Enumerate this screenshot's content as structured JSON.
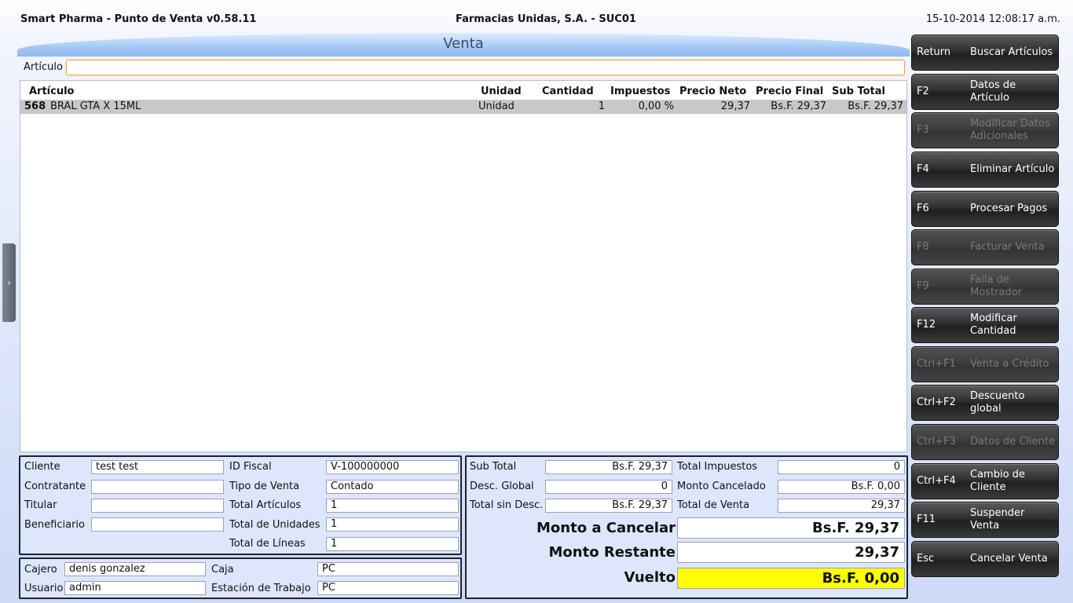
{
  "header": {
    "app_title": "Smart Pharma - Punto de Venta  v0.58.11",
    "company": "Farmacias Unidas, S.A.  -  SUC01",
    "datetime": "15-10-2014 12:08:17 a.m."
  },
  "venta": {
    "title": "Venta",
    "articulo_label": "Artículo",
    "articulo_value": ""
  },
  "grid": {
    "columns": [
      "Artículo",
      "Unidad",
      "Cantidad",
      "Impuestos",
      "Precio Neto",
      "Precio Final",
      "Sub Total"
    ],
    "rows": [
      {
        "code": "568",
        "name": "BRAL GTA X 15ML",
        "unidad": "Unidad",
        "cantidad": "1",
        "impuestos": "0,00 %",
        "precio_neto": "29,37",
        "precio_final": "Bs.F. 29,37",
        "sub_total": "Bs.F. 29,37"
      }
    ]
  },
  "cliente": {
    "cliente_label": "Cliente",
    "cliente_value": "test test",
    "contratante_label": "Contratante",
    "contratante_value": "",
    "titular_label": "Titular",
    "titular_value": "",
    "beneficiario_label": "Beneficiario",
    "beneficiario_value": "",
    "id_fiscal_label": "ID Fiscal",
    "id_fiscal_value": "V-100000000",
    "tipo_venta_label": "Tipo de Venta",
    "tipo_venta_value": "Contado",
    "total_articulos_label": "Total Artículos",
    "total_articulos_value": "1",
    "total_unidades_label": "Total de Unidades",
    "total_unidades_value": "1",
    "total_lineas_label": "Total de Líneas",
    "total_lineas_value": "1"
  },
  "cajero": {
    "cajero_label": "Cajero",
    "cajero_value": "denis gonzalez",
    "usuario_label": "Usuario",
    "usuario_value": "admin",
    "caja_label": "Caja",
    "caja_value": "PC",
    "estacion_label": "Estación de Trabajo",
    "estacion_value": "PC"
  },
  "totales": {
    "sub_total_label": "Sub Total",
    "sub_total_value": "Bs.F. 29,37",
    "desc_global_label": "Desc. Global",
    "desc_global_value": "0",
    "total_sin_desc_label": "Total sin Desc.",
    "total_sin_desc_value": "Bs.F. 29,37",
    "total_impuestos_label": "Total Impuestos",
    "total_impuestos_value": "0",
    "monto_cancelado_label": "Monto Cancelado",
    "monto_cancelado_value": "Bs.F. 0,00",
    "total_venta_label": "Total de Venta",
    "total_venta_value": "29,37",
    "monto_a_cancelar_label": "Monto a Cancelar",
    "monto_a_cancelar_value": "Bs.F. 29,37",
    "monto_restante_label": "Monto Restante",
    "monto_restante_value": "29,37",
    "vuelto_label": "Vuelto",
    "vuelto_value": "Bs.F. 0,00",
    "vuelto_color": "#ffff00"
  },
  "side_handle": {
    "glyph": "›",
    "icon": "chevron-right-icon"
  },
  "actions": [
    {
      "key": "Return",
      "label": "Buscar Artículos",
      "enabled": true
    },
    {
      "key": "F2",
      "label": "Datos de Artículo",
      "enabled": true
    },
    {
      "key": "F3",
      "label": "Modificar Datos Adicionales",
      "enabled": false
    },
    {
      "key": "F4",
      "label": "Eliminar Artículo",
      "enabled": true
    },
    {
      "key": "F6",
      "label": "Procesar Pagos",
      "enabled": true
    },
    {
      "key": "F8",
      "label": "Facturar Venta",
      "enabled": false
    },
    {
      "key": "F9",
      "label": "Falla de Mostrador",
      "enabled": false
    },
    {
      "key": "F12",
      "label": "Modificar Cantidad",
      "enabled": true
    },
    {
      "key": "Ctrl+F1",
      "label": "Venta a Crédito",
      "enabled": false
    },
    {
      "key": "Ctrl+F2",
      "label": "Descuento global",
      "enabled": true
    },
    {
      "key": "Ctrl+F3",
      "label": "Datos de Cliente",
      "enabled": false
    },
    {
      "key": "Ctrl+F4",
      "label": "Cambio de Cliente",
      "enabled": true
    },
    {
      "key": "F11",
      "label": "Suspender Venta",
      "enabled": true
    },
    {
      "key": "Esc",
      "label": "Cancelar Venta",
      "enabled": true
    }
  ]
}
